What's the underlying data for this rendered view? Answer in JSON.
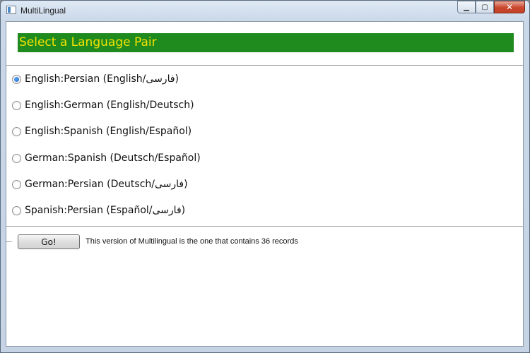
{
  "window": {
    "title": "MultiLingual",
    "minimize_glyph": "▁",
    "maximize_glyph": "▢",
    "close_glyph": "✕"
  },
  "header": {
    "title": "Select a Language Pair",
    "background": "#1f8b1f",
    "text_color": "#f2e200"
  },
  "language_pairs": [
    {
      "label": "English:Persian (English/فارسی)",
      "selected": true
    },
    {
      "label": "English:German (English/Deutsch)",
      "selected": false
    },
    {
      "label": "English:Spanish (English/Español)",
      "selected": false
    },
    {
      "label": "German:Spanish (Deutsch/Español)",
      "selected": false
    },
    {
      "label": "German:Persian (Deutsch/فارسی)",
      "selected": false
    },
    {
      "label": "Spanish:Persian (Español/فارسی)",
      "selected": false
    }
  ],
  "footer": {
    "go_label": "Go!",
    "status": "This version of Multilingual is the one that contains 36 records"
  }
}
